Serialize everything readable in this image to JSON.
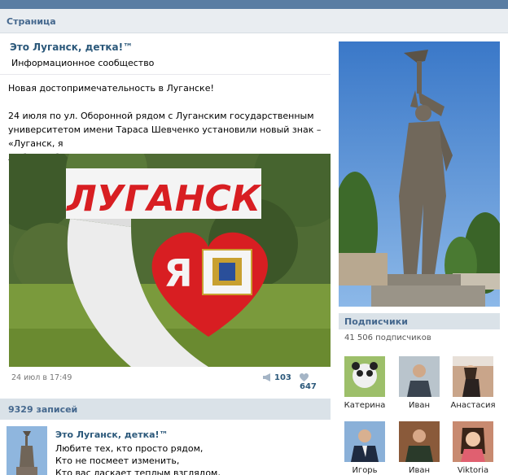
{
  "header": {
    "title": "Страница"
  },
  "post": {
    "community_name": "Это Луганск, детка!™",
    "community_type": "Информационное сообщество",
    "text_line1": "Новая достопримечательность в Луганске!",
    "text_line2": "24 июля по ул. Оборонной рядом с Луганским государственным",
    "text_line3": "университетом имени Тараса Шевченко установили новый знак – «Луганск, я",
    "text_line4": "люблю тебя».",
    "photo_sign_text": "ЛУГАНСК",
    "photo_heart_text": "Я",
    "date": "24 июл в 17:49",
    "reposts": "103",
    "likes": "647"
  },
  "records": {
    "label": "9329 записей",
    "item": {
      "name": "Это Луганск, детка!™",
      "line1": "Любите тех, кто просто рядом,",
      "line2": "Кто не посмеет изменить,",
      "line3": "Кто вас ласкает теплым взглядом,"
    }
  },
  "subscribers": {
    "label": "Подписчики",
    "count": "41 506 подписчиков",
    "members": [
      {
        "name": "Катерина",
        "color": "#9dbf6a"
      },
      {
        "name": "Иван",
        "color": "#5a6b7c"
      },
      {
        "name": "Анастасия",
        "color": "#c9a58a"
      },
      {
        "name": "Игорь",
        "color": "#4a6a9a"
      },
      {
        "name": "Иван",
        "color": "#8a5a3a"
      },
      {
        "name": "Viktoria",
        "color": "#c88a70"
      }
    ]
  },
  "colors": {
    "link": "#2b587a",
    "header_blue": "#597da3",
    "section_bg": "#dae2e8",
    "heart_red": "#d81e22"
  }
}
